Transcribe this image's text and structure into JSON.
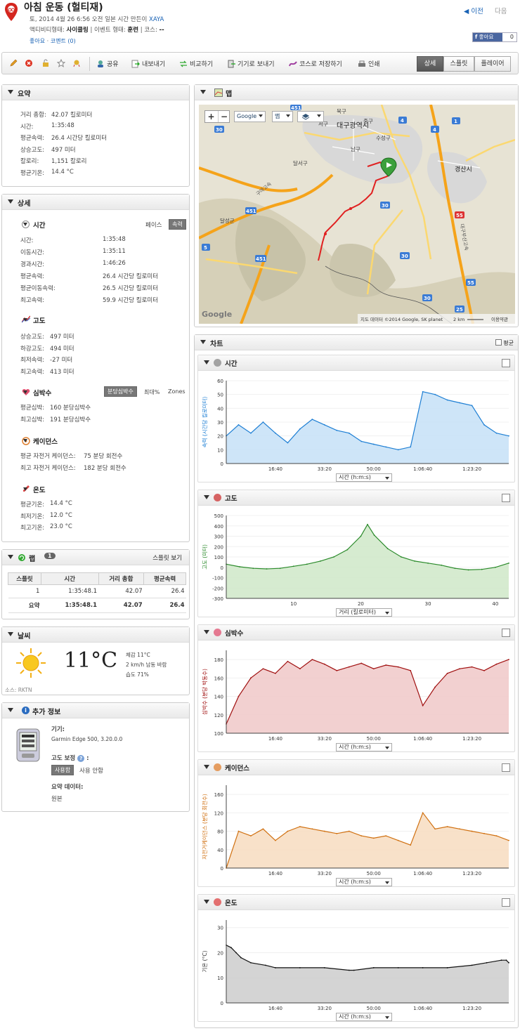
{
  "header": {
    "title": "아침 운동 (헐티재)",
    "date_prefix": "토, 2014 4월 26 6:56 오전 일본 시간 만든이",
    "author": "XAYA",
    "activity_type_label": "액티비티형태:",
    "activity_type": "사이클링",
    "event_type_label": "| 이벤트 형태:",
    "event_type": "훈련",
    "course_label": "| 코스:",
    "course": "--",
    "like_link": "좋아요",
    "comment_link": "코멘트 (0)",
    "prev": "이전",
    "next": "다음",
    "fb_like": "좋아요",
    "fb_count": "0"
  },
  "toolbar": {
    "share": "공유",
    "export": "내보내기",
    "compare": "비교하기",
    "send_device": "기기로 보내기",
    "save_course": "코스로 저장하기",
    "print": "인쇄",
    "tab_detail": "상세",
    "tab_splits": "스플릿",
    "tab_player": "플레이어"
  },
  "summary": {
    "title": "요약",
    "rows": [
      {
        "label": "거리 총합:",
        "value": "42.07 킬로미터"
      },
      {
        "label": "시간:",
        "value": "1:35:48"
      },
      {
        "label": "평균속력:",
        "value": "26.4 시간당 킬로미터"
      },
      {
        "label": "상승고도:",
        "value": "497 미터"
      },
      {
        "label": "칼로리:",
        "value": "1,151 칼로리"
      },
      {
        "label": "평균기온:",
        "value": "14.4 °C"
      }
    ]
  },
  "details": {
    "title": "상세",
    "time": {
      "title": "시간",
      "pace_label": "페이스",
      "speed_label": "속력",
      "rows": [
        {
          "label": "시간:",
          "value": "1:35:48"
        },
        {
          "label": "이동시간:",
          "value": "1:35:11"
        },
        {
          "label": "경과시간:",
          "value": "1:46:26"
        },
        {
          "label": "평균속력:",
          "value": "26.4 시간당 킬로미터"
        },
        {
          "label": "평균이동속력:",
          "value": "26.5 시간당 킬로미터"
        },
        {
          "label": "최고속력:",
          "value": "59.9 시간당 킬로미터"
        }
      ]
    },
    "elevation": {
      "title": "고도",
      "rows": [
        {
          "label": "상승고도:",
          "value": "497 미터"
        },
        {
          "label": "하강고도:",
          "value": "494 미터"
        },
        {
          "label": "최저속력:",
          "value": "-27 미터"
        },
        {
          "label": "최고속력:",
          "value": "413 미터"
        }
      ]
    },
    "heart": {
      "title": "심박수",
      "bpm_label": "분당심박수",
      "max_label": "최대%",
      "zones_label": "Zones",
      "rows": [
        {
          "label": "평균심박:",
          "value": "160 분당심박수"
        },
        {
          "label": "최고심박:",
          "value": "191 분당심박수"
        }
      ]
    },
    "cadence": {
      "title": "케이던스",
      "rows": [
        {
          "label": "평균 자전거 케이던스:",
          "value": "75 분당 회전수"
        },
        {
          "label": "최고 자전거 케이던스:",
          "value": "182 분당 회전수"
        }
      ]
    },
    "temp": {
      "title": "온도",
      "rows": [
        {
          "label": "평균기온:",
          "value": "14.4 °C"
        },
        {
          "label": "최저기온:",
          "value": "12.0 °C"
        },
        {
          "label": "최고기온:",
          "value": "23.0 °C"
        }
      ]
    }
  },
  "laps": {
    "title": "랩",
    "count": "1",
    "view_splits": "스플릿 보기",
    "headers": [
      "스플릿",
      "시간",
      "거리 총합",
      "평균속력"
    ],
    "rows": [
      [
        "1",
        "1:35:48.1",
        "42.07",
        "26.4"
      ]
    ],
    "summary": [
      "요약",
      "1:35:48.1",
      "42.07",
      "26.4"
    ]
  },
  "weather": {
    "title": "날씨",
    "temp": "11°C",
    "feels": "체감 11°C",
    "wind": "2 km/h 남동 바람",
    "humidity": "습도 71%",
    "source": "소스: RKTN"
  },
  "extra": {
    "title": "추가 정보",
    "device_label": "기기:",
    "device": "Garmin Edge 500, 3.20.0.0",
    "elev_corr_label": "고도 보정",
    "elev_corr_on": "사용함",
    "elev_corr_off": "사용 안함",
    "summary_data_label": "요약 데이터:",
    "summary_data_value": "원본"
  },
  "map": {
    "title": "맵",
    "google_btn": "Google",
    "map_btn": "맵",
    "city1": "대구광역시",
    "city2": "경산시",
    "district1": "달서구",
    "district2": "남구",
    "district3": "수성구",
    "district4": "북구",
    "district5": "서구",
    "district6": "달성군",
    "district7": "중구",
    "road1": "구마고속",
    "road2": "대구부산고속",
    "attribution": "지도 데이터 ©2014 Google, SK planet",
    "scale": "2 km",
    "terms": "이용약관",
    "google_logo": "Google",
    "route_color": "#e02020"
  },
  "charts_panel": {
    "title": "차트",
    "avg_label": "평균"
  },
  "chart_data": [
    {
      "type": "area",
      "title": "시간",
      "ylabel": "속력 (시간당 킬로미터)",
      "xlabel": "시간 (h:m:s)",
      "color": "#1e7fd4",
      "fill": "#c5e1f7",
      "x_ticks": [
        "16:40",
        "33:20",
        "50:00",
        "1:06:40",
        "1:23:20"
      ],
      "y_ticks": [
        0,
        10,
        20,
        30,
        40,
        50,
        60
      ],
      "ylim": [
        0,
        60
      ],
      "x_range_sec": [
        0,
        5750
      ],
      "x": [
        0,
        250,
        500,
        750,
        1000,
        1250,
        1500,
        1750,
        2000,
        2250,
        2500,
        2750,
        3000,
        3250,
        3500,
        3750,
        4000,
        4250,
        4500,
        4750,
        5000,
        5250,
        5500,
        5750
      ],
      "values": [
        20,
        28,
        22,
        30,
        22,
        15,
        25,
        32,
        28,
        24,
        22,
        16,
        14,
        12,
        10,
        12,
        52,
        50,
        46,
        44,
        42,
        28,
        22,
        20
      ]
    },
    {
      "type": "area",
      "title": "고도",
      "ylabel": "고도 (미터)",
      "xlabel": "거리 (킬로미터)",
      "color": "#2a8a2a",
      "fill": "#cfe8c8",
      "x_ticks": [
        "10",
        "20",
        "30",
        "40"
      ],
      "y_ticks": [
        -300,
        -200,
        -100,
        0,
        100,
        200,
        300,
        400,
        500
      ],
      "ylim": [
        -300,
        500
      ],
      "x": [
        0,
        2,
        4,
        6,
        8,
        10,
        12,
        14,
        16,
        18,
        20,
        21,
        22,
        24,
        26,
        28,
        30,
        32,
        34,
        36,
        38,
        40,
        42
      ],
      "values": [
        30,
        5,
        -10,
        -15,
        -10,
        10,
        30,
        60,
        100,
        170,
        300,
        413,
        310,
        180,
        100,
        60,
        40,
        20,
        -10,
        -25,
        -20,
        0,
        40
      ]
    },
    {
      "type": "area",
      "title": "심박수",
      "ylabel": "심박수 (분당 박동수)",
      "xlabel": "시간 (h:m:s)",
      "color": "#a01010",
      "fill": "#f0c8c8",
      "x_ticks": [
        "16:40",
        "33:20",
        "50:00",
        "1:06:40",
        "1:23:20"
      ],
      "y_ticks": [
        100,
        120,
        140,
        160,
        180
      ],
      "ylim": [
        100,
        190
      ],
      "x_range_sec": [
        0,
        5750
      ],
      "x": [
        0,
        250,
        500,
        750,
        1000,
        1250,
        1500,
        1750,
        2000,
        2250,
        2500,
        2750,
        3000,
        3250,
        3500,
        3750,
        4000,
        4250,
        4500,
        4750,
        5000,
        5250,
        5500,
        5750
      ],
      "values": [
        110,
        140,
        160,
        170,
        165,
        178,
        170,
        180,
        175,
        168,
        172,
        176,
        170,
        174,
        172,
        168,
        130,
        150,
        165,
        170,
        172,
        168,
        175,
        180
      ]
    },
    {
      "type": "area",
      "title": "케이던스",
      "ylabel": "자전거케이던스 (분당 회전수)",
      "xlabel": "시간 (h:m:s)",
      "color": "#d07010",
      "fill": "#f7dcc0",
      "x_ticks": [
        "16:40",
        "33:20",
        "50:00",
        "1:06:40",
        "1:23:20"
      ],
      "y_ticks": [
        0,
        40,
        80,
        120,
        160
      ],
      "ylim": [
        0,
        180
      ],
      "x_range_sec": [
        0,
        5750
      ],
      "x": [
        0,
        250,
        500,
        750,
        1000,
        1250,
        1500,
        1750,
        2000,
        2250,
        2500,
        2750,
        3000,
        3250,
        3500,
        3750,
        4000,
        4250,
        4500,
        4750,
        5000,
        5250,
        5500,
        5750
      ],
      "values": [
        0,
        80,
        70,
        85,
        60,
        80,
        90,
        85,
        80,
        75,
        80,
        70,
        65,
        70,
        60,
        50,
        120,
        85,
        90,
        85,
        80,
        75,
        70,
        60
      ]
    },
    {
      "type": "area",
      "title": "온도",
      "ylabel": "기온 (°C)",
      "xlabel": "시간 (h:m:s)",
      "color": "#111111",
      "fill": "#cccccc",
      "x_ticks": [
        "16:40",
        "33:20",
        "50:00",
        "1:06:40",
        "1:23:20"
      ],
      "y_ticks": [
        0,
        10,
        20,
        30
      ],
      "ylim": [
        0,
        33
      ],
      "x_range_sec": [
        0,
        5750
      ],
      "x": [
        0,
        100,
        200,
        300,
        500,
        800,
        1000,
        1500,
        2000,
        2500,
        2600,
        3000,
        3500,
        4000,
        4500,
        5000,
        5300,
        5600,
        5700,
        5750
      ],
      "values": [
        23,
        22,
        20,
        18,
        16,
        15,
        14,
        14,
        14,
        13,
        13,
        14,
        14,
        14,
        14,
        15,
        16,
        17,
        17,
        16
      ]
    }
  ]
}
